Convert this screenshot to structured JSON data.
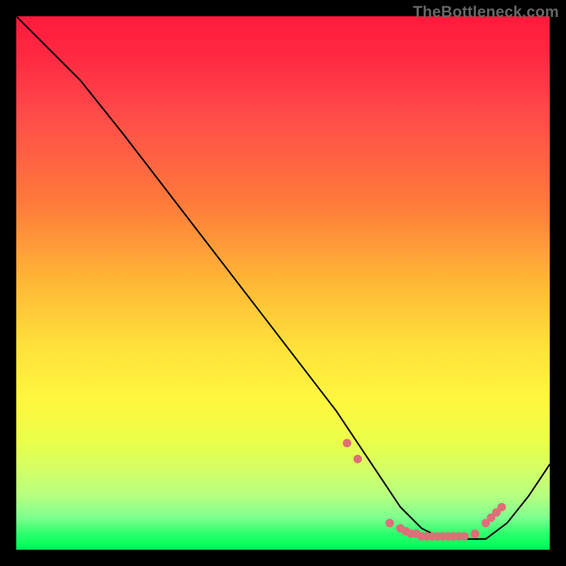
{
  "watermark": "TheBottleneck.com",
  "colors": {
    "page_bg": "#000000",
    "curve": "#000000",
    "marker": "#e06d78",
    "gradient_top": "#ff1a3c",
    "gradient_bottom": "#00e85a"
  },
  "chart_data": {
    "type": "line",
    "title": "",
    "xlabel": "",
    "ylabel": "",
    "xlim": [
      0,
      100
    ],
    "ylim": [
      0,
      100
    ],
    "note": "No axis ticks or numeric labels are rendered; values are pixel-relative estimates (0–100 each axis) read off the curve geometry.",
    "series": [
      {
        "name": "curve",
        "x": [
          0,
          8,
          12,
          20,
          30,
          40,
          50,
          60,
          68,
          72,
          76,
          80,
          84,
          88,
          92,
          96,
          100
        ],
        "y": [
          100,
          92,
          88,
          78,
          65,
          52,
          39,
          26,
          14,
          8,
          4,
          2,
          2,
          2,
          5,
          10,
          16
        ]
      }
    ],
    "markers": {
      "name": "highlight-points",
      "x": [
        62,
        64,
        70,
        72,
        73,
        74,
        75,
        76,
        77,
        78,
        79,
        80,
        81,
        82,
        83,
        84,
        86,
        88,
        89,
        90,
        91
      ],
      "y": [
        20,
        17,
        5,
        4,
        3.5,
        3,
        3,
        2.5,
        2.5,
        2.5,
        2.5,
        2.5,
        2.5,
        2.5,
        2.5,
        2.5,
        3,
        5,
        6,
        7,
        8
      ]
    }
  }
}
